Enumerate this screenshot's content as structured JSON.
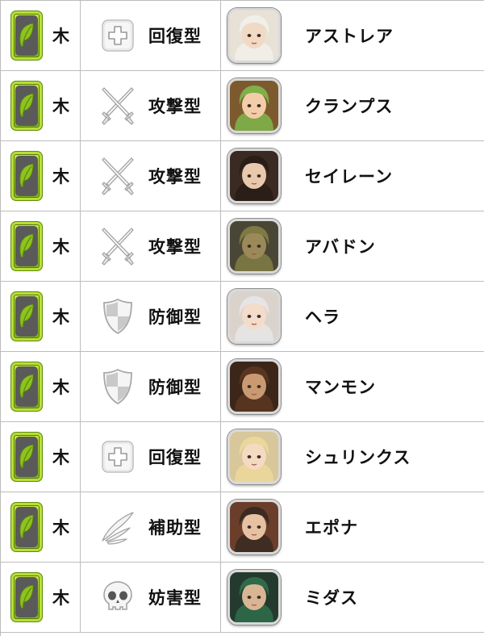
{
  "rows": [
    {
      "attribute": "木",
      "type_icon": "cross-icon",
      "type": "回復型",
      "name": "アストレア",
      "portrait_bg": "#e8e2d6",
      "portrait_hair": "#f1efe9",
      "portrait_skin": "#f1d9c4"
    },
    {
      "attribute": "木",
      "type_icon": "crossed-swords-icon",
      "type": "攻撃型",
      "name": "クランプス",
      "portrait_bg": "#7d5a2e",
      "portrait_hair": "#7fb04a",
      "portrait_skin": "#f3cda8"
    },
    {
      "attribute": "木",
      "type_icon": "crossed-swords-icon",
      "type": "攻撃型",
      "name": "セイレーン",
      "portrait_bg": "#3a2a22",
      "portrait_hair": "#2a1d18",
      "portrait_skin": "#e9c9ae"
    },
    {
      "attribute": "木",
      "type_icon": "crossed-swords-icon",
      "type": "攻撃型",
      "name": "アバドン",
      "portrait_bg": "#4a4636",
      "portrait_hair": "#7d7a44",
      "portrait_skin": "#9b8a58"
    },
    {
      "attribute": "木",
      "type_icon": "shield-icon",
      "type": "防御型",
      "name": "ヘラ",
      "portrait_bg": "#dad3cc",
      "portrait_hair": "#e7e4e6",
      "portrait_skin": "#f3dcca"
    },
    {
      "attribute": "木",
      "type_icon": "shield-icon",
      "type": "防御型",
      "name": "マンモン",
      "portrait_bg": "#3b2619",
      "portrait_hair": "#5a3621",
      "portrait_skin": "#c99a72"
    },
    {
      "attribute": "木",
      "type_icon": "cross-icon",
      "type": "回復型",
      "name": "シュリンクス",
      "portrait_bg": "#d7c79a",
      "portrait_hair": "#ecd79a",
      "portrait_skin": "#f4dac0"
    },
    {
      "attribute": "木",
      "type_icon": "wing-icon",
      "type": "補助型",
      "name": "エポナ",
      "portrait_bg": "#6b3e2b",
      "portrait_hair": "#3b2a22",
      "portrait_skin": "#e7c2a2"
    },
    {
      "attribute": "木",
      "type_icon": "skull-icon",
      "type": "妨害型",
      "name": "ミダス",
      "portrait_bg": "#243a2e",
      "portrait_hair": "#2f6a4a",
      "portrait_skin": "#d9b693"
    }
  ],
  "colors": {
    "attr_green": "#a3cc2a",
    "leaf_green": "#8ec21e",
    "icon_gray": "#cfcfcf",
    "border": "#bdbdbd"
  }
}
